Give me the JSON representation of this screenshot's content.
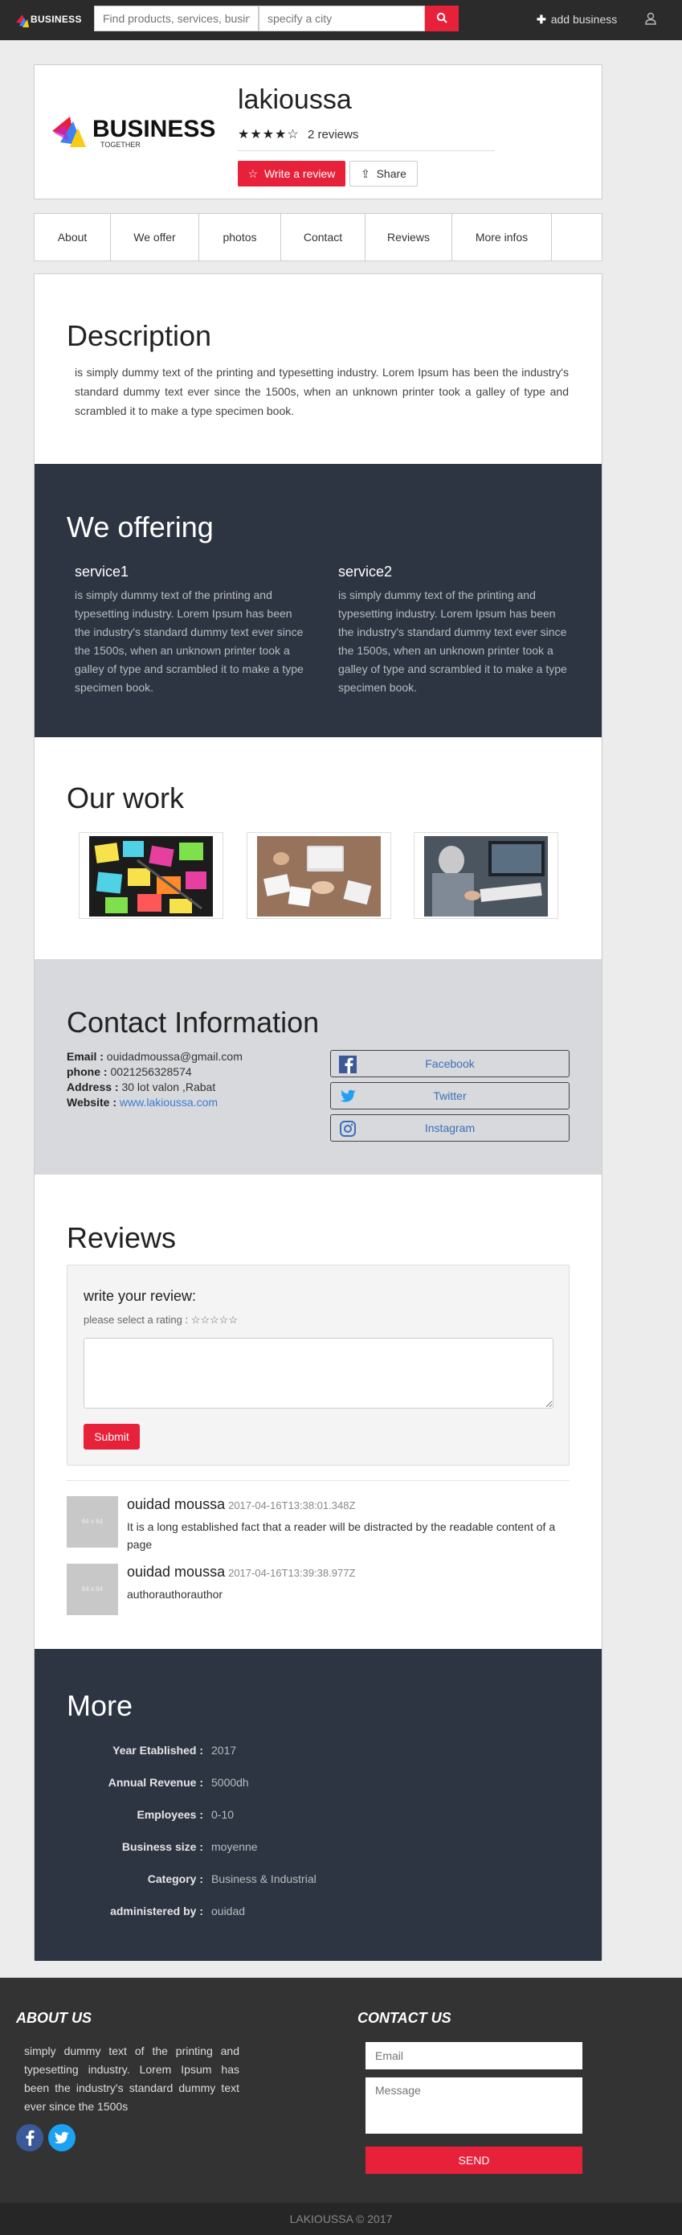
{
  "navbar": {
    "logo_text": "BUSINESS",
    "search_placeholder": "Find products, services, business",
    "city_placeholder": "specify a city",
    "add_business_label": "add business"
  },
  "header": {
    "logo_title": "BUSINESS",
    "logo_subtitle": "TOGETHER",
    "business_name": "lakioussa",
    "stars": "★★★★☆",
    "rating": 4,
    "rating_max": 5,
    "reviews_count": "2 reviews",
    "write_review_label": "Write a review",
    "share_label": "Share"
  },
  "tabs": [
    {
      "label": "About"
    },
    {
      "label": "We offer"
    },
    {
      "label": "photos"
    },
    {
      "label": "Contact"
    },
    {
      "label": "Reviews"
    },
    {
      "label": "More infos"
    }
  ],
  "description": {
    "title": "Description",
    "text": "is simply dummy text of the printing and typesetting industry. Lorem Ipsum has been the industry's standard dummy text ever since the 1500s, when an unknown printer took a galley of type and scrambled it to make a type specimen book."
  },
  "offering": {
    "title": "We offering",
    "services": [
      {
        "name": "service1",
        "text": "is simply dummy text of the printing and typesetting industry. Lorem Ipsum has been the industry's standard dummy text ever since the 1500s, when an unknown printer took a galley of type and scrambled it to make a type specimen book."
      },
      {
        "name": "service2",
        "text": "is simply dummy text of the printing and typesetting industry. Lorem Ipsum has been the industry's standard dummy text ever since the 1500s, when an unknown printer took a galley of type and scrambled it to make a type specimen book."
      }
    ]
  },
  "work": {
    "title": "Our work"
  },
  "contact": {
    "title": "Contact Information",
    "email_label": "Email :",
    "email": "ouidadmoussa@gmail.com",
    "phone_label": "phone :",
    "phone": "0021256328574",
    "address_label": "Address :",
    "address": "30 lot valon ,Rabat",
    "website_label": "Website :",
    "website": "www.lakioussa.com",
    "facebook": "Facebook",
    "twitter": "Twitter",
    "instagram": "Instagram"
  },
  "reviews": {
    "title": "Reviews",
    "form_title": "write your review:",
    "rating_prompt": "please select a rating :",
    "rating_stars": "☆☆☆☆☆",
    "submit_label": "Submit",
    "items": [
      {
        "author": "ouidad moussa",
        "date": "2017-04-16T13:38:01.348Z",
        "text": "It is a long established fact that a reader will be distracted by the readable content of a page",
        "avatar_text": "64 x 64"
      },
      {
        "author": "ouidad moussa",
        "date": "2017-04-16T13:39:38.977Z",
        "text": "authorauthorauthor",
        "avatar_text": "64 x 64"
      }
    ]
  },
  "more": {
    "title": "More",
    "rows": [
      {
        "label": "Year Etablished :",
        "value": "2017"
      },
      {
        "label": "Annual Revenue :",
        "value": "5000dh"
      },
      {
        "label": "Employees :",
        "value": "0-10"
      },
      {
        "label": "Business size :",
        "value": "moyenne"
      },
      {
        "label": "Category :",
        "value": "Business & Industrial"
      },
      {
        "label": "administered by :",
        "value": "ouidad"
      }
    ]
  },
  "footer": {
    "about_title": "ABOUT US",
    "about_text": "simply dummy text of the printing and typesetting industry. Lorem Ipsum has been the industry's standard dummy text ever since the 1500s",
    "contact_title": "CONTACT US",
    "email_placeholder": "Email",
    "message_placeholder": "Message",
    "send_label": "SEND",
    "copyright": "LAKIOUSSA © 2017"
  },
  "colors": {
    "accent": "#e8213a",
    "navbar": "#2b2b2b",
    "dark_section": "#2d3542",
    "contact_section": "#d8d9dc",
    "footer": "#333333"
  }
}
